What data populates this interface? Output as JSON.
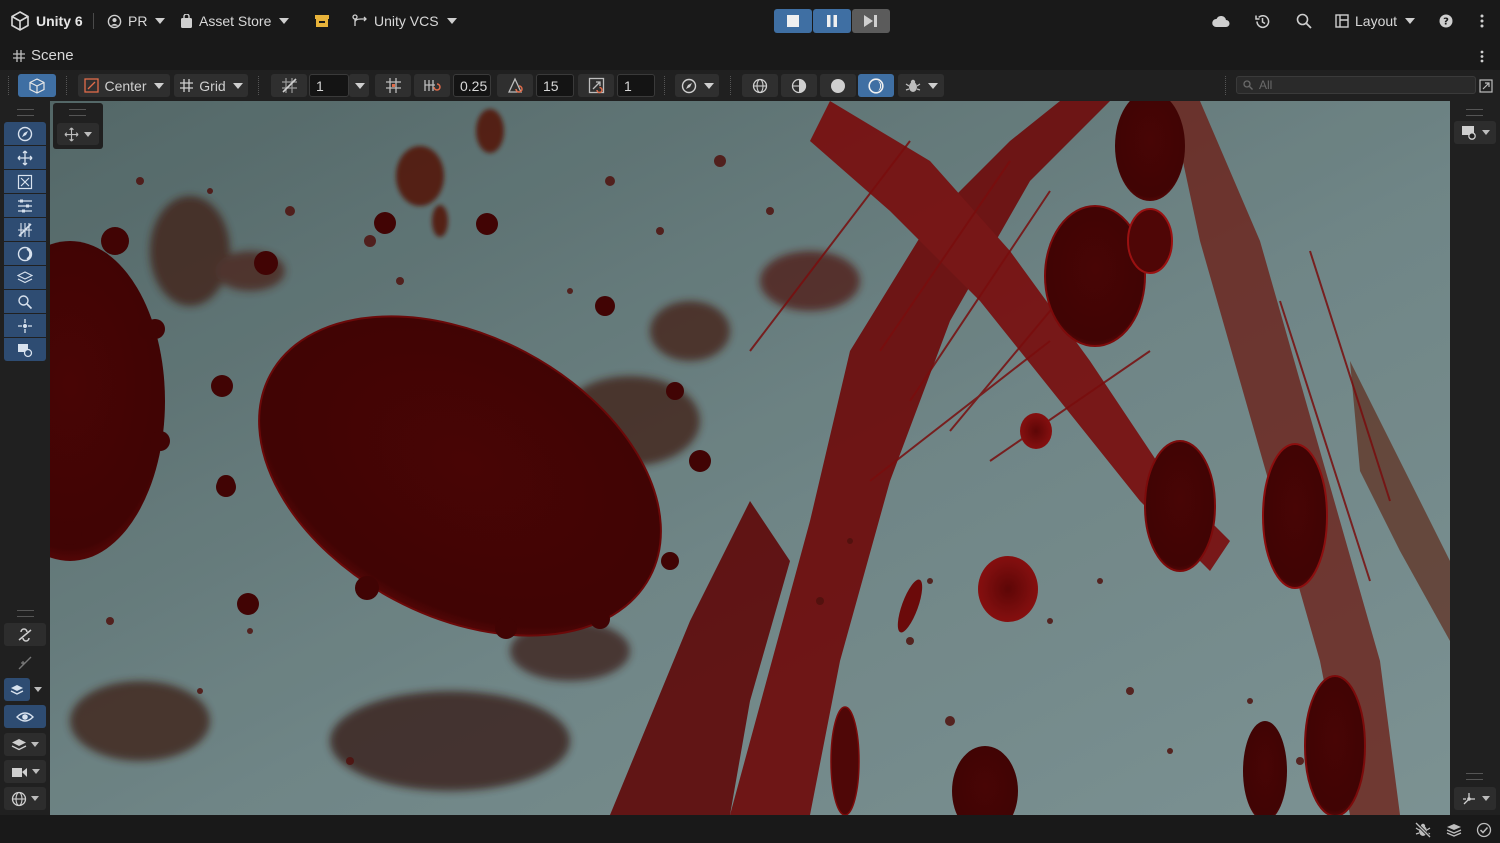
{
  "topbar": {
    "app_name": "Unity 6",
    "account": "PR",
    "asset_store": "Asset Store",
    "vcs": "Unity VCS",
    "layout": "Layout"
  },
  "scene_tab": {
    "title": "Scene"
  },
  "toolbar": {
    "pivot_mode": "Center",
    "grid_label": "Grid",
    "grid_size": "1",
    "snap_increment": "0.25",
    "rotation_snap": "15",
    "scale_snap": "1",
    "search_placeholder": "All"
  },
  "colors": {
    "accent_blue": "#3f6fa3",
    "panel_dark": "#191919",
    "toolbar_bg": "#202020",
    "blood_dark": "#4a0606",
    "blood_red": "#a31212",
    "sky": "#8fa9aa"
  },
  "icons": {
    "unity_logo": "unity-logo-icon",
    "account": "account-icon",
    "asset_store": "shopping-bag-icon",
    "vcs": "branch-icon",
    "package": "package-icon",
    "stop": "stop-icon",
    "pause": "pause-icon",
    "step": "step-icon",
    "cloud": "cloud-icon",
    "history": "history-icon",
    "search": "search-icon",
    "layout": "layout-icon",
    "help": "help-icon",
    "more": "more-vertical-icon"
  }
}
